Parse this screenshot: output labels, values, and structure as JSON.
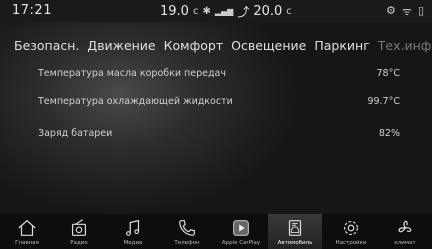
{
  "status": {
    "time": "17:21",
    "temp_left": "19.0",
    "temp_left_unit": "c",
    "fan_icon": "fan-icon",
    "temp_right": "20.0",
    "temp_right_unit": "c",
    "icons": [
      "network-icon",
      "phone-signal-icon",
      "battery-icon"
    ]
  },
  "tabs": [
    {
      "label": "Безопасн.",
      "enabled": true
    },
    {
      "label": "Движение",
      "enabled": true
    },
    {
      "label": "Комфорт",
      "enabled": true
    },
    {
      "label": "Освещение",
      "enabled": true
    },
    {
      "label": "Паркинг",
      "enabled": true
    },
    {
      "label": "Тех.инфо",
      "enabled": false
    }
  ],
  "rows": [
    {
      "label": "Температура масла коробки передач",
      "value": "78°C"
    },
    {
      "label": "Температура охлаждающей жидкости",
      "value": "99.7°C"
    },
    {
      "label": "Заряд батареи",
      "value": "82%"
    }
  ],
  "nav": [
    {
      "label": "Главная",
      "icon": "home-icon"
    },
    {
      "label": "Радио",
      "icon": "radio-icon"
    },
    {
      "label": "Медиа",
      "icon": "music-note-icon"
    },
    {
      "label": "Телефон",
      "icon": "phone-icon"
    },
    {
      "label": "Apple CarPlay",
      "icon": "carplay-icon"
    },
    {
      "label": "Автомобиль",
      "icon": "car-info-icon",
      "active": true
    },
    {
      "label": "Настройки",
      "icon": "gear-icon"
    },
    {
      "label": "климат",
      "icon": "fan-icon"
    }
  ]
}
